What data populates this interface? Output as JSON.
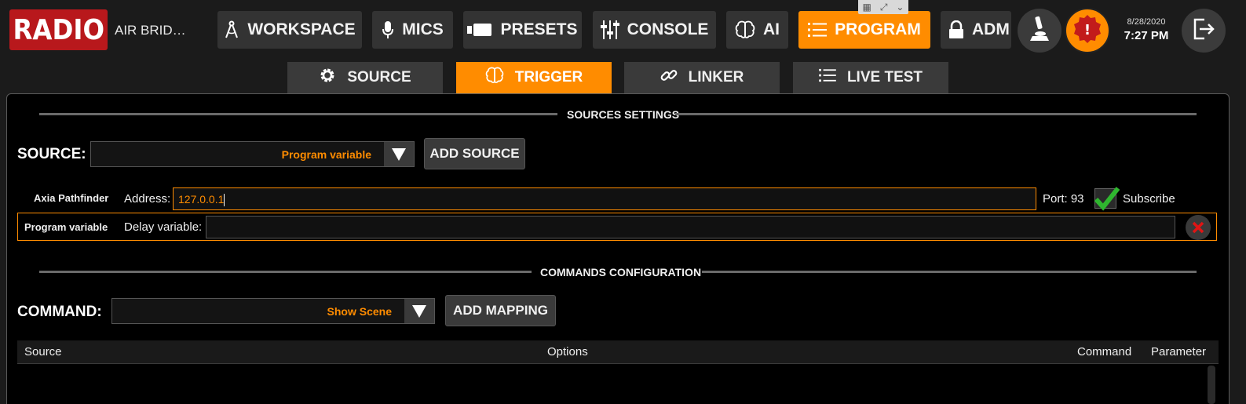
{
  "header": {
    "logo_text": "RADIO",
    "station_name": "AIR BRID…",
    "nav": [
      {
        "label": "WORKSPACE",
        "icon": "compass-icon"
      },
      {
        "label": "MICS",
        "icon": "microphone-icon"
      },
      {
        "label": "PRESETS",
        "icon": "camera-icon"
      },
      {
        "label": "CONSOLE",
        "icon": "sliders-icon"
      },
      {
        "label": "AI",
        "icon": "brain-icon"
      },
      {
        "label": "PROGRAM",
        "icon": "list-icon",
        "active": true
      },
      {
        "label": "ADM",
        "icon": "lock-icon"
      }
    ],
    "date": "8/28/2020",
    "time": "7:27 PM",
    "accent_color": "#ff8c00",
    "logo_color": "#b8181c"
  },
  "subtabs": [
    {
      "label": "SOURCE",
      "icon": "gear-icon"
    },
    {
      "label": "TRIGGER",
      "icon": "brain-icon",
      "active": true
    },
    {
      "label": "LINKER",
      "icon": "link-icon"
    },
    {
      "label": "LIVE TEST",
      "icon": "list-icon"
    }
  ],
  "sources_settings": {
    "title": "SOURCES SETTINGS",
    "source_label": "SOURCE:",
    "source_value": "Program variable",
    "add_source_label": "ADD SOURCE",
    "axia": {
      "name": "Axia Pathfinder",
      "address_label": "Address:",
      "address_value": "127.0.0.1",
      "port_text": "Port: 93",
      "subscribe_label": "Subscribe",
      "subscribed": true
    },
    "program_var": {
      "name": "Program variable",
      "delay_label": "Delay variable:",
      "delay_value": ""
    }
  },
  "commands": {
    "title": "COMMANDS CONFIGURATION",
    "command_label": "COMMAND:",
    "command_value": "Show Scene",
    "add_mapping_label": "ADD MAPPING",
    "columns": [
      "Source",
      "Options",
      "Command",
      "Parameter"
    ]
  }
}
